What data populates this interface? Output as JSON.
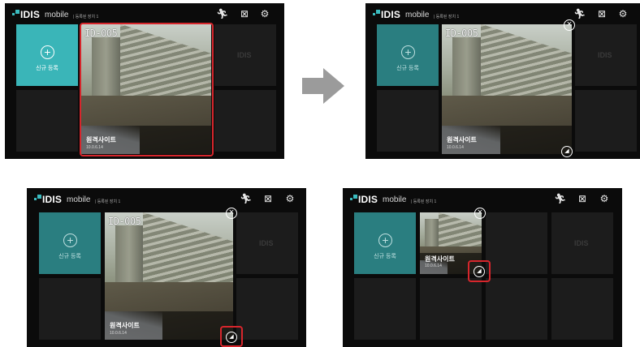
{
  "app": {
    "brand": "IDIS",
    "mobile": "mobile",
    "subtitle": "| 등록된 장치 1"
  },
  "icons": {
    "run": "running-man-icon",
    "close_box": "close-box-icon",
    "settings": "gear-icon"
  },
  "tile": {
    "add_plus": "+",
    "add_label": "신규 등록"
  },
  "camera": {
    "osd": "ID-005",
    "site": "원격사이트",
    "ip": "10.0.6.14"
  },
  "ghost_logo": "IDIS",
  "controls": {
    "close": "×",
    "resize": "◢"
  },
  "colors": {
    "teal": "#3ab5b8",
    "highlight": "#d7262c",
    "arrow": "#9b9b9b"
  }
}
